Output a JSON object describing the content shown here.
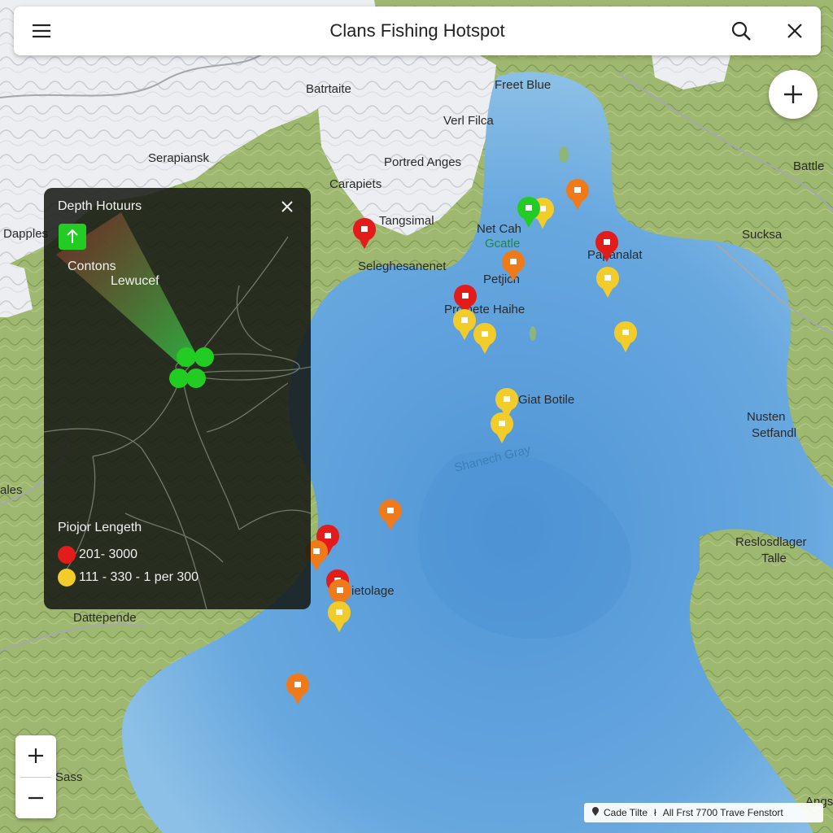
{
  "header": {
    "title": "Clans Fishing Hotspot",
    "menu_icon": "hamburger-menu-icon",
    "search_icon": "search-icon",
    "close_icon": "close-icon"
  },
  "add_button": {
    "icon": "plus-icon"
  },
  "map_labels": {
    "batrtaite": "Batrtaite",
    "freet_blue": "Freet Blue",
    "vert_filca": "Verl Filca",
    "serapiansk": "Serapiansk",
    "portred_anges": "Portred Anges",
    "carapiets": "Carapiets",
    "battle": "Battle",
    "tangsimal": "Tangsimal",
    "net_cah": "Net Cah",
    "gcatle": "Gcatle",
    "sucksa": "Sucksa",
    "papanalat": "Papanalat",
    "dapples": "Dapples",
    "seleghesanenet": "Seleghesanenet",
    "petjicn": "Petjicn",
    "proinete_haihe": "Proinete Haihe",
    "giat_botile": "Giat Botile",
    "nusten": "Nusten",
    "setfandl": "Setfandl",
    "shanech_gray": "Shanech Gray",
    "ales": "ales",
    "reslosdlager": "Reslosdlager",
    "talle": "Talle",
    "ietolage": "ietolage",
    "dattepende": "Dattepende",
    "sass": "Sass",
    "angs": "Angs"
  },
  "overlay": {
    "title": "Depth Hotuurs",
    "close_icon": "close-icon",
    "toggle_icon": "green-marker-icon",
    "label_contons": "Contons",
    "label_lewucef": "Lewucef",
    "legend_title": "Piojor Lengeth",
    "legend": [
      {
        "color": "#e21b1b",
        "label": "201- 3000"
      },
      {
        "color": "#f2cc2a",
        "label": "111 - 330 - 1 per 300"
      }
    ]
  },
  "markers": {
    "red": [
      "hotspot-pin",
      "hotspot-pin",
      "hotspot-pin",
      "hotspot-pin",
      "hotspot-pin"
    ],
    "colors": {
      "red": "#e21b1b",
      "orange": "#ef7a1a",
      "yellow": "#f2cc2a",
      "green": "#22cc22"
    }
  },
  "zoom": {
    "in_icon": "zoom-in-icon",
    "out_icon": "zoom-out-icon"
  },
  "attribution": {
    "left_text": "Cade Tilte",
    "right_text": "All Frst 7700 Trave Fenstort"
  },
  "colors": {
    "water": "#7db4e0",
    "water_deep": "#4e94d4",
    "land": "#9bb56c",
    "snow": "#eceef1"
  }
}
